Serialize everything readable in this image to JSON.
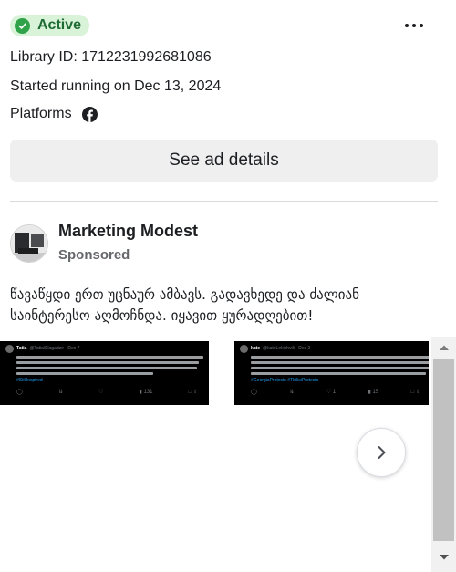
{
  "status": {
    "label": "Active",
    "color": "#30a24a"
  },
  "menu": {
    "icon": "more-options-icon"
  },
  "info": {
    "library_id": "Library ID: 1712231992681086",
    "started": "Started running on Dec 13, 2024",
    "platforms_label": "Platforms",
    "platform_icon": "facebook-icon"
  },
  "details_button": {
    "label": "See ad details"
  },
  "advertiser": {
    "name": "Marketing Modest",
    "sponsored": "Sponsored"
  },
  "ad": {
    "text": "წავაწყდი ერთ უცნაურ ამბავს. გადავხედე და ძალიან საინტერესო აღმოჩნდა. იყავით ყურადღებით!"
  },
  "carousel": {
    "cards": [
      {
        "name": "Tatia",
        "handle": "@TatiaSilagadze · Dec 7",
        "hashtags": "#StillInspired",
        "replies": "",
        "reposts": "",
        "likes": "",
        "views": "131"
      },
      {
        "name": "kate",
        "handle": "@kateLekishvili · Dec 2",
        "hashtags": "#GeorgiaProtests #TbilisiProtests",
        "replies": "",
        "reposts": "",
        "likes": "1",
        "views": "15"
      }
    ],
    "next_icon": "chevron-right-icon"
  },
  "scrollbar": {
    "up_icon": "scroll-up-arrow-icon",
    "down_icon": "scroll-down-arrow-icon"
  }
}
